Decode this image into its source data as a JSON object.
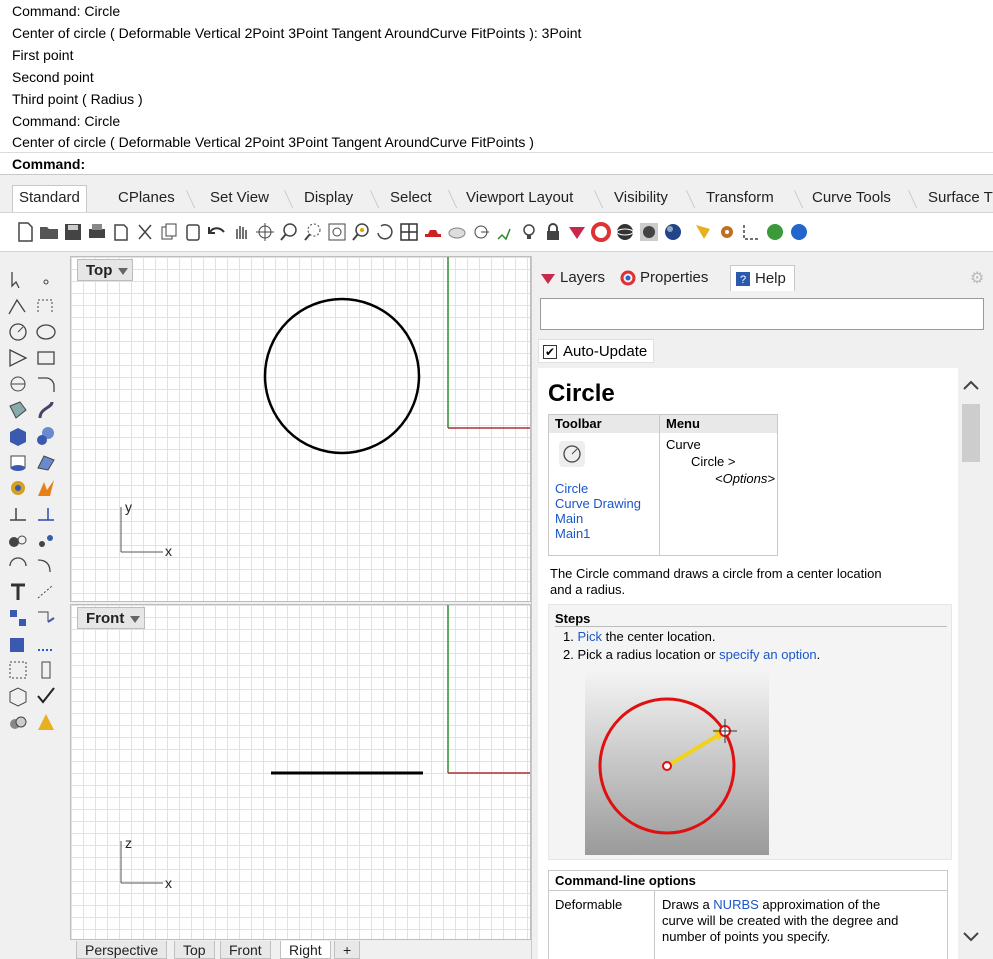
{
  "command_history": {
    "lines": [
      "Command: Circle",
      "Center of circle ( Deformable  Vertical  2Point  3Point  Tangent  AroundCurve  FitPoints ): 3Point",
      "First point",
      "Second point",
      "Third point ( Radius )",
      "Command: Circle",
      "Center of circle ( Deformable  Vertical  2Point  3Point  Tangent  AroundCurve  FitPoints )"
    ],
    "prompt": "Command:"
  },
  "toolbar_tabs": [
    "Standard",
    "CPlanes",
    "Set View",
    "Display",
    "Select",
    "Viewport Layout",
    "Visibility",
    "Transform",
    "Curve Tools",
    "Surface T"
  ],
  "viewports": {
    "top": {
      "label": "Top",
      "axis_v": "y",
      "axis_h": "x"
    },
    "front": {
      "label": "Front",
      "axis_v": "z",
      "axis_h": "x"
    }
  },
  "viewport_tabs": [
    "Perspective",
    "Top",
    "Front",
    "Right",
    "+"
  ],
  "panel": {
    "tabs": [
      "Layers",
      "Properties",
      "Help"
    ],
    "search_value": "",
    "auto_update_label": "Auto-Update",
    "auto_update_checked": "✔"
  },
  "help": {
    "title": "Circle",
    "table_head_toolbar": "Toolbar",
    "table_head_menu": "Menu",
    "toolbar_links": [
      "Circle",
      "Curve Drawing",
      "Main",
      "Main1"
    ],
    "menu_path": [
      "Curve",
      "Circle >",
      "<Options>"
    ],
    "description": [
      "The Circle command draws a circle from a center location",
      "and a radius."
    ],
    "steps_title": "Steps",
    "step1": {
      "num": "1.",
      "link": "Pick",
      "rest": " the center location."
    },
    "step2": {
      "num": "2.",
      "text": "Pick a radius location or ",
      "link": "specify an option",
      "end": "."
    },
    "options_title": "Command-line options",
    "opt_name": "Deformable",
    "opt_desc_1_pre": "Draws a ",
    "opt_desc_1_link": "NURBS",
    "opt_desc_1_post": " approximation of the",
    "opt_desc_2": "curve will be created with the degree and",
    "opt_desc_3": "number of points you specify."
  },
  "colors": {
    "x_axis": "#a83232",
    "y_axis": "#2f8f2f",
    "link": "#1a56c8",
    "illustration_circle": "#e01010"
  }
}
